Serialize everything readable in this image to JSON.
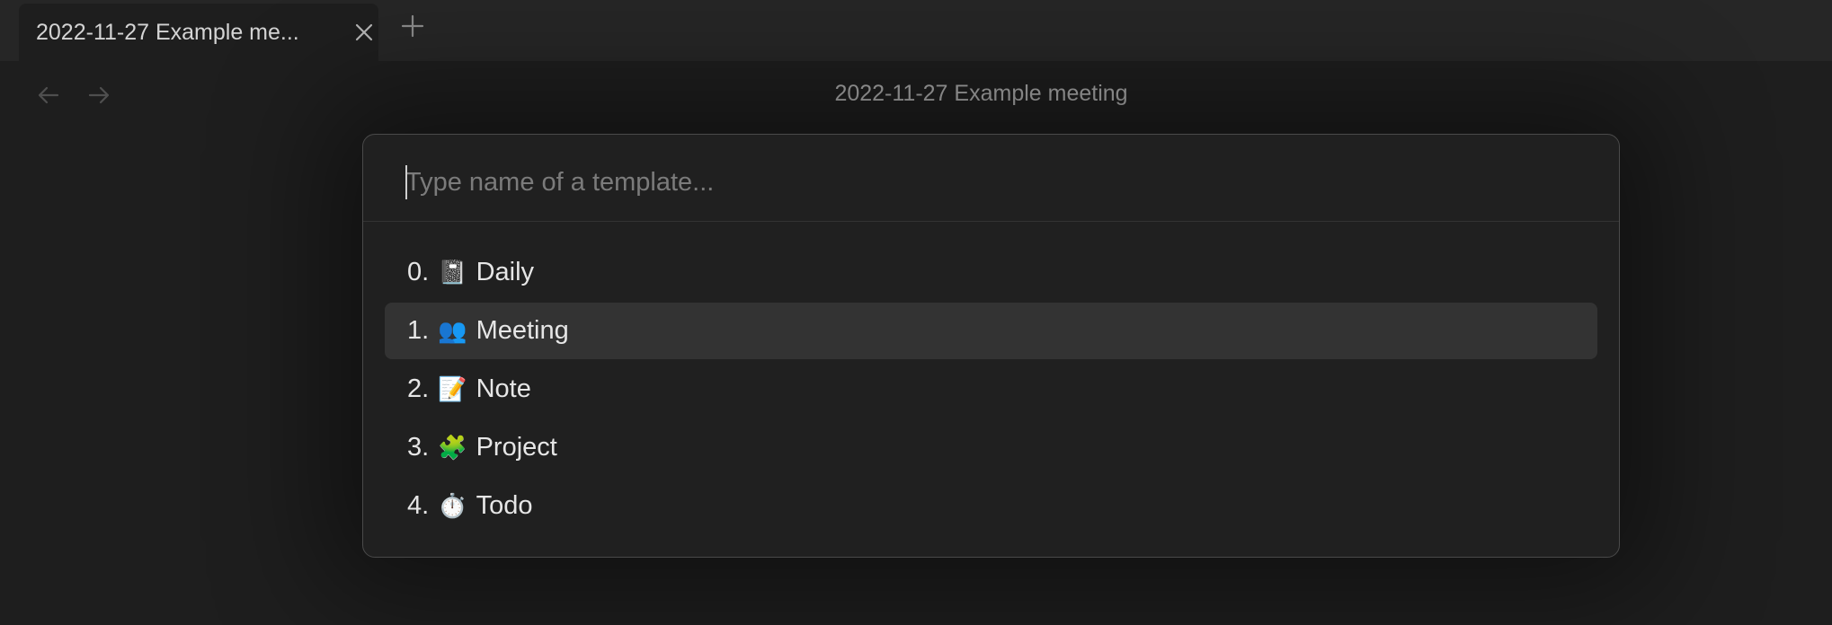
{
  "tabs": [
    {
      "title": "2022-11-27 Example me...",
      "active": true
    }
  ],
  "header": {
    "view_title": "2022-11-27 Example meeting"
  },
  "icons": {
    "tab_close": "close-icon",
    "new_tab": "plus-icon",
    "back": "arrow-left-icon",
    "forward": "arrow-right-icon"
  },
  "prompt": {
    "placeholder": "Type name of a template...",
    "value": ""
  },
  "results": [
    {
      "number": "0.",
      "emoji": "📓",
      "label": "Daily",
      "selected": false
    },
    {
      "number": "1.",
      "emoji": "👥",
      "label": "Meeting",
      "selected": true
    },
    {
      "number": "2.",
      "emoji": "📝",
      "label": "Note",
      "selected": false
    },
    {
      "number": "3.",
      "emoji": "🧩",
      "label": "Project",
      "selected": false
    },
    {
      "number": "4.",
      "emoji": "⏱️",
      "label": "Todo",
      "selected": false
    }
  ],
  "colors": {
    "background": "#1e1e1e",
    "tabbar": "#262626",
    "modal": "#202020",
    "selected_row": "#333333",
    "text": "#e6e6e6",
    "muted_text": "#a8a8a8"
  }
}
